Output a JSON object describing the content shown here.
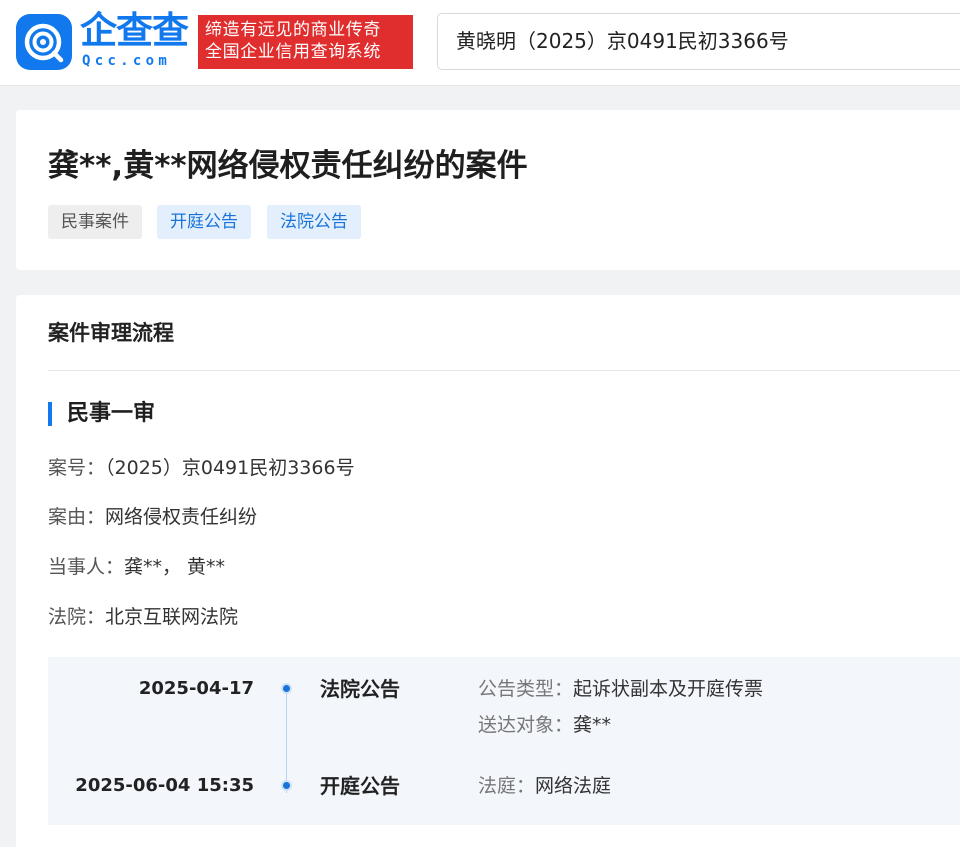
{
  "header": {
    "logo_text": "企查查",
    "logo_domain": "Qcc.com",
    "slogan_line1": "缔造有远见的商业传奇",
    "slogan_line2": "全国企业信用查询系统",
    "search_value": "黄晓明（2025）京0491民初3366号"
  },
  "case": {
    "title": "龚**,黄**网络侵权责任纠纷的案件",
    "tags": [
      "民事案件",
      "开庭公告",
      "法院公告"
    ]
  },
  "flow": {
    "section_title": "案件审理流程",
    "stage_title": "民事一审",
    "case_no_label": "案号：",
    "case_no": "（2025）京0491民初3366号",
    "cause_label": "案由：",
    "cause": "网络侵权责任纠纷",
    "parties_label": "当事人：",
    "parties": "龚**， 黄**",
    "court_label": "法院：",
    "court": "北京互联网法院",
    "timeline": [
      {
        "date": "2025-04-17",
        "type": "法院公告",
        "details": [
          {
            "label": "公告类型：",
            "value": "起诉状副本及开庭传票"
          },
          {
            "label": "送达对象：",
            "value": "龚**"
          }
        ]
      },
      {
        "date": "2025-06-04 15:35",
        "type": "开庭公告",
        "details": [
          {
            "label": "法庭：",
            "value": "网络法庭"
          }
        ]
      }
    ]
  },
  "colors": {
    "brand_blue": "#1278ee",
    "slogan_red": "#e02e2e",
    "tag_blue_text": "#1a73d9"
  }
}
